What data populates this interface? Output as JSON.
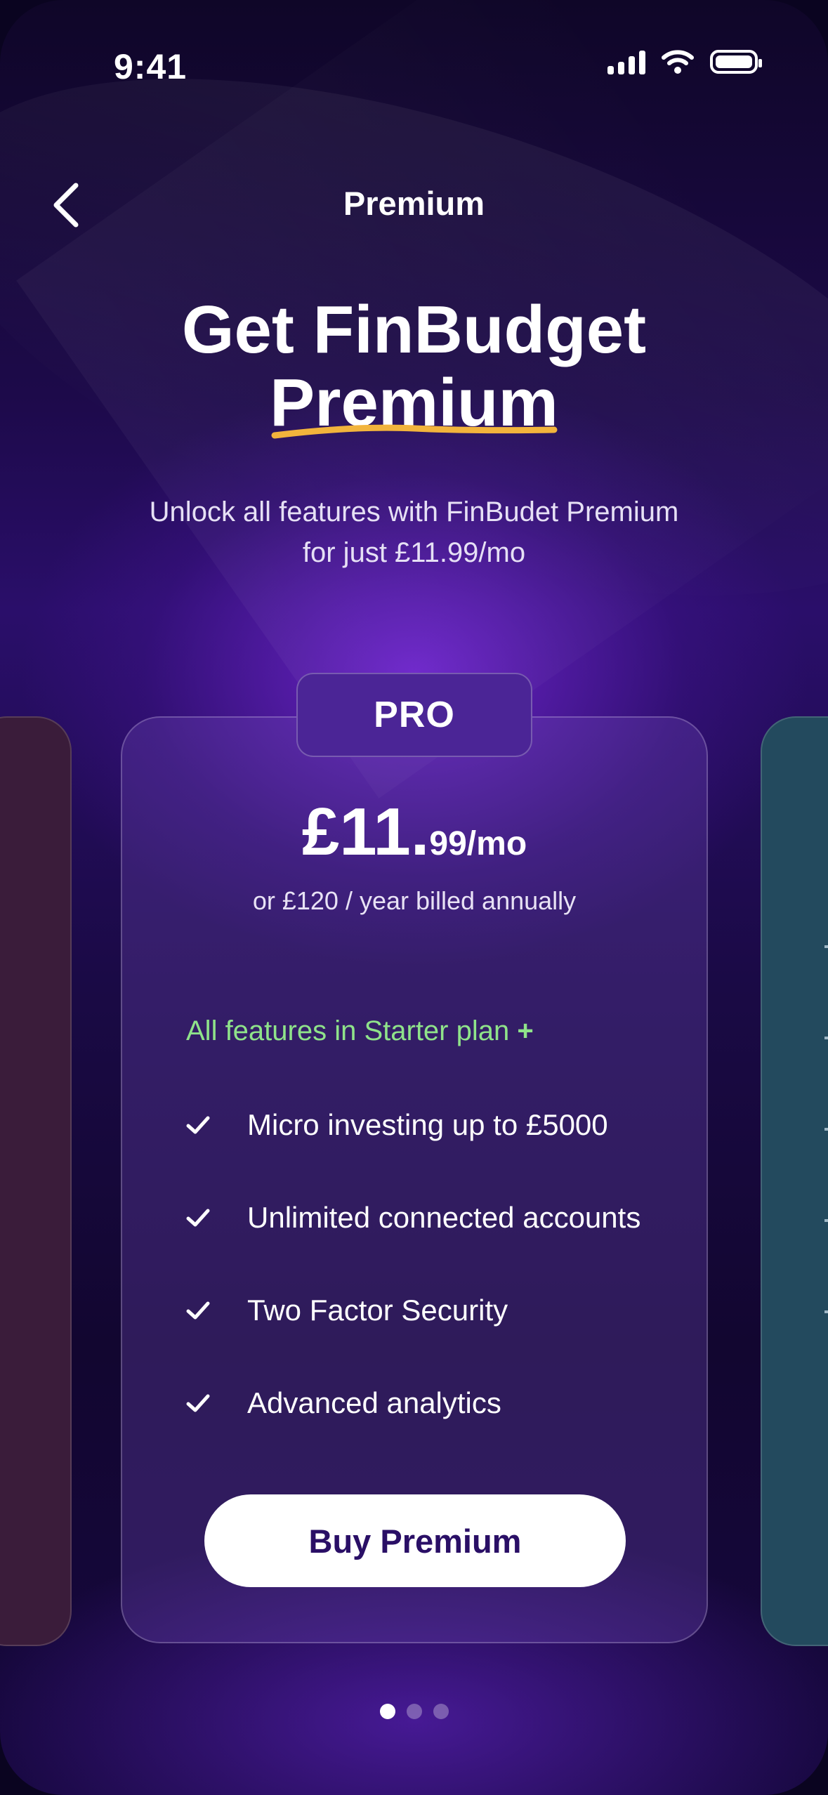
{
  "status_bar": {
    "time": "9:41"
  },
  "nav": {
    "title": "Premium"
  },
  "hero": {
    "headline_line1": "Get FinBudget",
    "headline_line2": "Premium",
    "subtitle_line1": "Unlock all features with FinBudet Premium",
    "subtitle_line2": "for just £11.99/mo",
    "underline_color": "#f2b43c"
  },
  "plan": {
    "tab_label": "PRO",
    "price_main": "£11.",
    "price_cents": "99/mo",
    "billing_note": "or  £120 / year billed annually",
    "features_heading": "All features in Starter plan",
    "features_heading_suffix": "+",
    "features": [
      "Micro investing up to £5000",
      "Unlimited connected accounts",
      "Two Factor Security",
      "Advanced analytics"
    ],
    "cta_label": "Buy Premium"
  },
  "pagination": {
    "count": 3,
    "active_index": 0
  },
  "colors": {
    "accent_green": "#8fe38a",
    "left_card": "#3a1c3a",
    "right_card": "#234a5e",
    "cta_text": "#2a0f66"
  },
  "icons": [
    "back-chevron-icon",
    "signal-icon",
    "wifi-icon",
    "battery-icon",
    "check-icon"
  ]
}
